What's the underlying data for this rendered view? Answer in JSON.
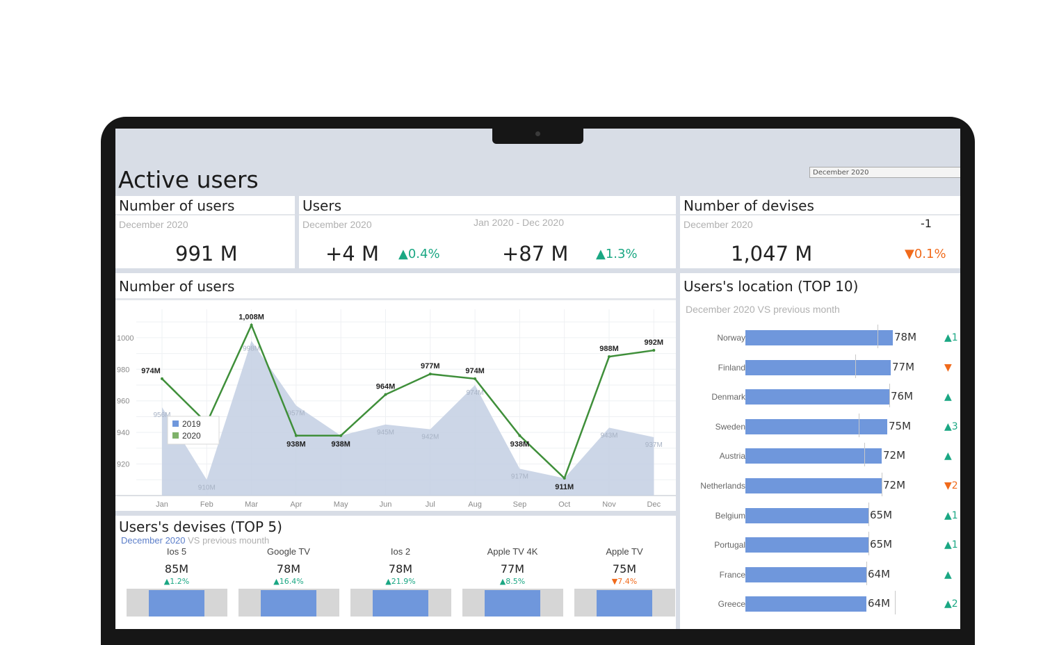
{
  "header": {
    "title": "Active users",
    "period_select": "December 2020"
  },
  "kpis": {
    "users_count": {
      "title": "Number of users",
      "period": "December 2020",
      "value": "991 M"
    },
    "users_growth": {
      "title": "Users",
      "period_left": "December 2020",
      "period_right": "Jan 2020 - Dec 2020",
      "left_value": "+4 M",
      "left_delta": "▲0.4%",
      "right_value": "+87 M",
      "right_delta": "▲1.3%"
    },
    "devices": {
      "title": "Number of devises",
      "period": "December 2020",
      "rank_change": "-1",
      "value": "1,047 M",
      "delta": "▼0.1%"
    }
  },
  "line_chart_title": "Number of users",
  "chart_data": {
    "type": "line",
    "categories": [
      "Jan",
      "Feb",
      "Mar",
      "Apr",
      "May",
      "Jun",
      "Jul",
      "Aug",
      "Sep",
      "Oct",
      "Nov",
      "Dec"
    ],
    "series": [
      {
        "name": "2019",
        "kind": "area",
        "values": [
          956,
          910,
          998,
          957,
          938,
          945,
          942,
          970,
          917,
          911,
          943,
          937
        ],
        "labels": [
          "956M",
          "910M",
          "998M",
          "957M",
          "938M",
          "945M",
          "942M",
          "974M",
          "917M",
          "",
          "943M",
          "937M"
        ]
      },
      {
        "name": "2020",
        "kind": "line",
        "values": [
          974,
          946,
          1008,
          938,
          938,
          964,
          977,
          974,
          938,
          911,
          988,
          992
        ],
        "labels": [
          "974M",
          "",
          "1,008M",
          "938M",
          "938M",
          "964M",
          "977M",
          "974M",
          "938M",
          "911M",
          "988M",
          "992M"
        ]
      }
    ],
    "y_ticks": [
      "1000",
      "980",
      "960",
      "940",
      "920"
    ],
    "ylim": [
      900,
      1018
    ],
    "colors": {
      "2019": "#c3cfe3",
      "2020": "#3f8f3a"
    },
    "legend": "left",
    "grid": true
  },
  "devices_top5": {
    "title": "Users's devises (TOP 5)",
    "subtitle_a": "December 2020",
    "subtitle_b": "VS previous mounth",
    "items": [
      {
        "name": "Ios 5",
        "value": "85M",
        "delta": "▲1.2%",
        "dir": "up"
      },
      {
        "name": "Google TV",
        "value": "78M",
        "delta": "▲16.4%",
        "dir": "up"
      },
      {
        "name": "Ios 2",
        "value": "78M",
        "delta": "▲21.9%",
        "dir": "up"
      },
      {
        "name": "Apple TV 4K",
        "value": "77M",
        "delta": "▲8.5%",
        "dir": "up"
      },
      {
        "name": "Apple TV",
        "value": "75M",
        "delta": "▼7.4%",
        "dir": "down"
      }
    ]
  },
  "location_top10": {
    "title": "Users's location (TOP 10)",
    "subtitle": "December 2020 VS previous month",
    "items": [
      {
        "country": "Norway",
        "value": 78,
        "label": "78M",
        "prev": 70,
        "delta": "▲1",
        "dir": "up"
      },
      {
        "country": "Finland",
        "value": 77,
        "label": "77M",
        "prev": 58,
        "delta": "▼",
        "dir": "down"
      },
      {
        "country": "Denmark",
        "value": 76,
        "label": "76M",
        "prev": 76,
        "delta": "▲",
        "dir": "up"
      },
      {
        "country": "Sweden",
        "value": 75,
        "label": "75M",
        "prev": 60,
        "delta": "▲3",
        "dir": "up"
      },
      {
        "country": "Austria",
        "value": 72,
        "label": "72M",
        "prev": 63,
        "delta": "▲",
        "dir": "up"
      },
      {
        "country": "Netherlands",
        "value": 72,
        "label": "72M",
        "prev": 72,
        "delta": "▼2",
        "dir": "down"
      },
      {
        "country": "Belgium",
        "value": 65,
        "label": "65M",
        "prev": 65,
        "delta": "▲1",
        "dir": "up"
      },
      {
        "country": "Portugal",
        "value": 65,
        "label": "65M",
        "prev": 65,
        "delta": "▲1",
        "dir": "up"
      },
      {
        "country": "France",
        "value": 64,
        "label": "64M",
        "prev": 64,
        "delta": "▲",
        "dir": "up"
      },
      {
        "country": "Greece",
        "value": 64,
        "label": "64M",
        "prev": 79,
        "delta": "▲2",
        "dir": "up"
      }
    ]
  }
}
